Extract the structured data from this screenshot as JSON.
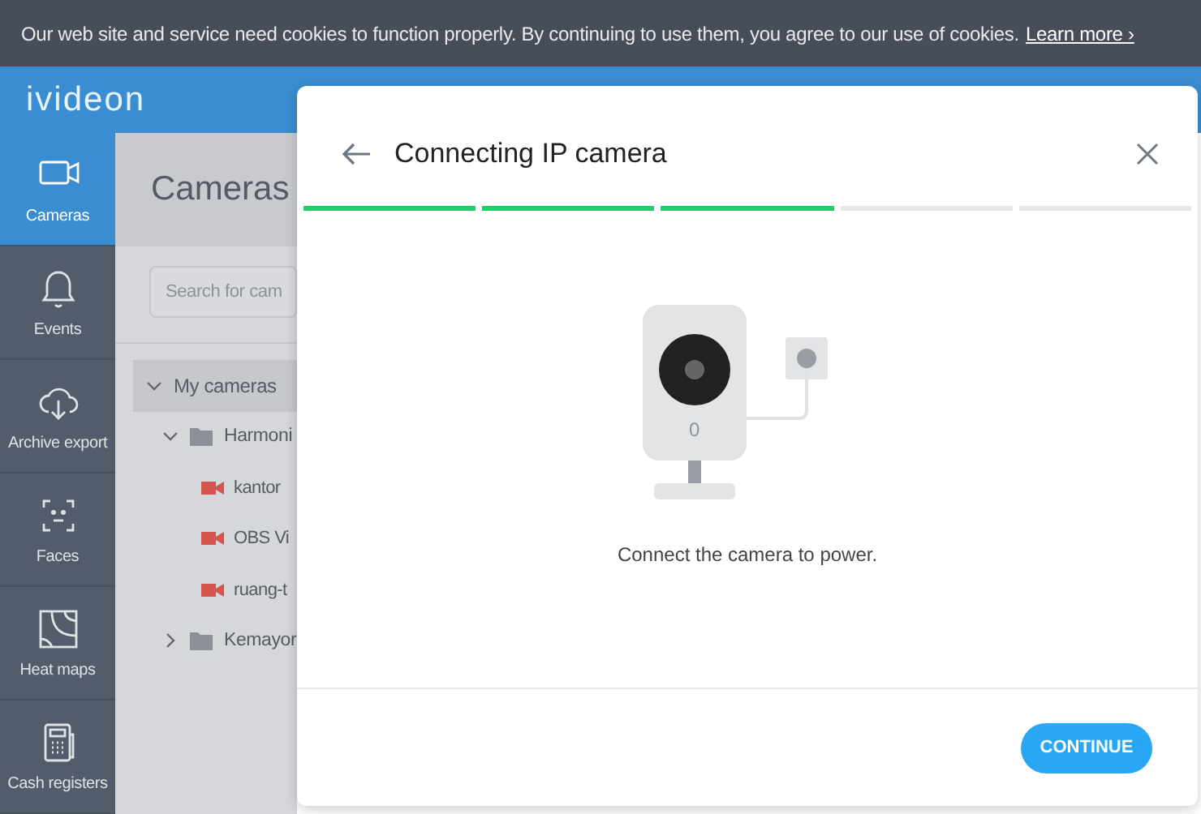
{
  "cookie_banner": {
    "text": "Our web site and service need cookies to function properly. By continuing to use them, you agree to our use of cookies.",
    "link": "Learn more ›"
  },
  "header": {
    "logo": "ivideon"
  },
  "sidebar": {
    "items": [
      {
        "label": "Cameras",
        "selected": true
      },
      {
        "label": "Events",
        "selected": false
      },
      {
        "label": "Archive export",
        "selected": false
      },
      {
        "label": "Faces",
        "selected": false
      },
      {
        "label": "Heat maps",
        "selected": false
      },
      {
        "label": "Cash registers",
        "selected": false
      }
    ]
  },
  "cameras_panel": {
    "title": "Cameras",
    "search": {
      "placeholder": "Search for cam"
    },
    "tree": [
      {
        "label": "My cameras",
        "kind": "group",
        "expanded": true,
        "selected": true,
        "children": [
          {
            "label": "Harmoni",
            "kind": "folder",
            "expanded": true,
            "selected": false,
            "children": [
              {
                "label": "kantor",
                "kind": "camera",
                "selected": false
              },
              {
                "label": "OBS Vi",
                "kind": "camera",
                "selected": false
              },
              {
                "label": "ruang-t",
                "kind": "camera",
                "selected": false
              }
            ]
          },
          {
            "label": "Kemayor",
            "kind": "folder",
            "expanded": false,
            "selected": false
          }
        ]
      }
    ]
  },
  "dialog": {
    "title": "Connecting IP camera",
    "steps": [
      {
        "completed": true
      },
      {
        "completed": true
      },
      {
        "completed": true
      },
      {
        "completed": false
      },
      {
        "completed": false
      }
    ],
    "camera_led": "0",
    "instruction": "Connect the camera to power.",
    "button": "CONTINUE"
  }
}
